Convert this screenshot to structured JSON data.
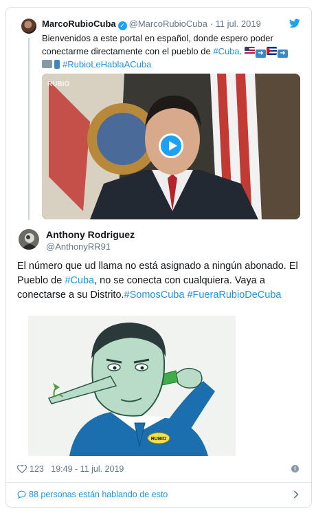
{
  "quoted_tweet": {
    "name": "MarcoRubioCuba",
    "handle": "@MarcoRubioCuba",
    "date": "11 jul. 2019",
    "text_before_tag": "Bienvenidos a este portal en español, donde espero poder conectarme directamente con el pueblo de ",
    "tag_cuba": "#Cuba",
    "tag_cuba_suffix": ".",
    "hashtag_2": "#RubioLeHablaACuba",
    "video_watermark": "RUBIO"
  },
  "main_tweet": {
    "name": "Anthony Rodriguez",
    "handle": "@AnthonyRR91",
    "text_1": "El número que ud llama no está asignado a ningún abonado. El Pueblo de ",
    "tag_cuba": "#Cuba",
    "text_2": ", no se conecta con cualquiera. Vaya a conectarse a su Distrito.",
    "tag_somos": "#SomosCuba",
    "tag_fuera": "#FueraRubioDeCuba",
    "cartoon_label": "RUBIO"
  },
  "footer": {
    "likes": "123",
    "time": "19:49 - 11 jul. 2019",
    "talking": "88 personas están hablando de esto"
  },
  "colors": {
    "link": "#1b95e0",
    "twitter_blue": "#1da1f2",
    "muted": "#657786"
  }
}
